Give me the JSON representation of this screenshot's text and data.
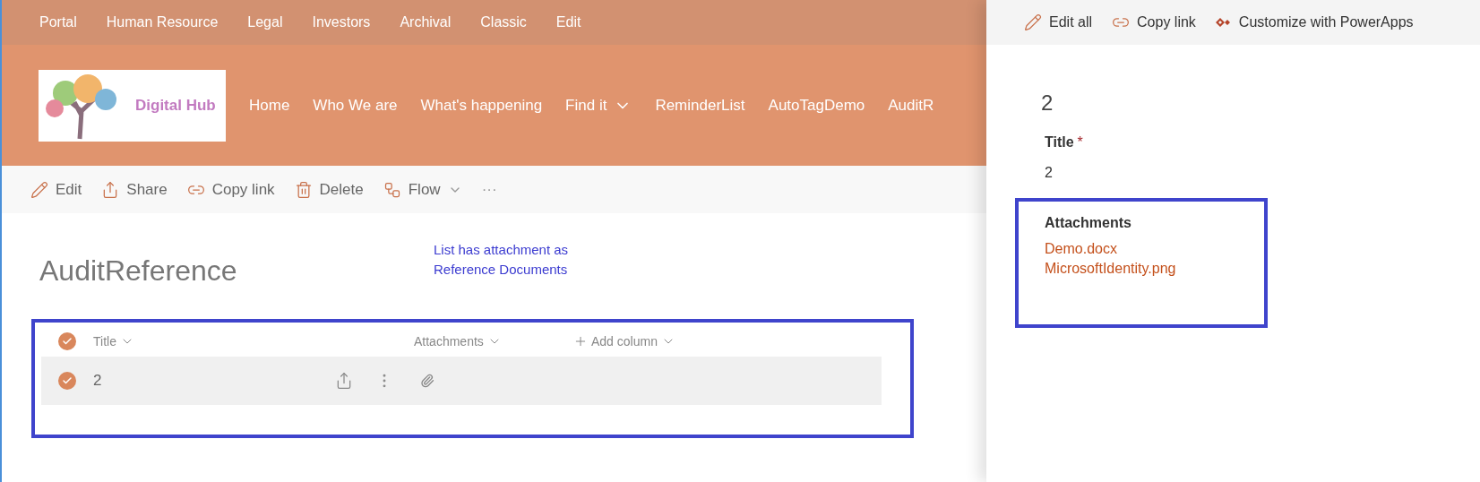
{
  "top_nav": [
    "Portal",
    "Human Resource",
    "Legal",
    "Investors",
    "Archival",
    "Classic",
    "Edit"
  ],
  "logo": {
    "text": "Digital Hub"
  },
  "site_nav": [
    {
      "label": "Home",
      "has_menu": false
    },
    {
      "label": "Who We are",
      "has_menu": false
    },
    {
      "label": "What's happening",
      "has_menu": false
    },
    {
      "label": "Find it",
      "has_menu": true
    },
    {
      "label": "ReminderList",
      "has_menu": false
    },
    {
      "label": "AutoTagDemo",
      "has_menu": false
    },
    {
      "label": "AuditR",
      "has_menu": false
    }
  ],
  "command_bar": [
    {
      "kind": "edit",
      "label": "Edit"
    },
    {
      "kind": "share",
      "label": "Share"
    },
    {
      "kind": "link",
      "label": "Copy link"
    },
    {
      "kind": "delete",
      "label": "Delete"
    },
    {
      "kind": "flow",
      "label": "Flow"
    },
    {
      "kind": "more",
      "label": "···"
    }
  ],
  "list": {
    "title": "AuditReference",
    "all_selected": true,
    "note": "List has attachment as Reference Documents",
    "columns": [
      {
        "label": "Title",
        "kind": "column"
      },
      {
        "label": "Attachments",
        "kind": "column"
      },
      {
        "label": "Add column",
        "kind": "add"
      }
    ],
    "rows": [
      {
        "title": "2",
        "selected": true,
        "has_attachment": true
      }
    ]
  },
  "panel": {
    "commands": [
      {
        "kind": "edit",
        "label": "Edit all"
      },
      {
        "kind": "link",
        "label": "Copy link"
      },
      {
        "kind": "powerapps",
        "label": "Customize with PowerApps"
      }
    ],
    "heading": "2",
    "fields": [
      {
        "label": "Title",
        "required_mark": "*",
        "value": "2"
      }
    ],
    "attachments": {
      "label": "Attachments",
      "files": [
        "Demo.docx",
        "MicrosoftIdentity.png"
      ]
    }
  }
}
